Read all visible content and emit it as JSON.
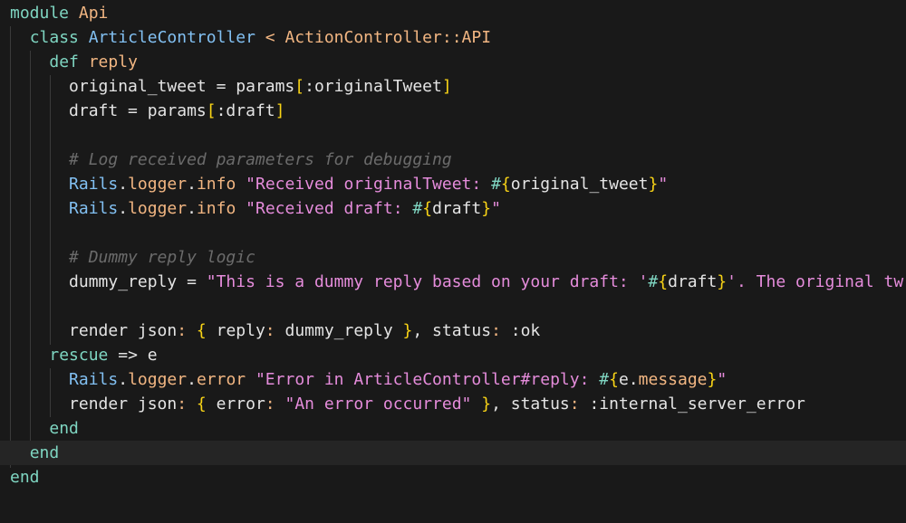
{
  "editor": {
    "current_line": 19,
    "lines": [
      [
        [
          "k",
          "module"
        ],
        [
          "w",
          " "
        ],
        [
          "o",
          "Api"
        ]
      ],
      [
        [
          "w",
          "  "
        ],
        [
          "k",
          "class"
        ],
        [
          "w",
          " "
        ],
        [
          "c",
          "ArticleController"
        ],
        [
          "o",
          " < "
        ],
        [
          "o",
          "ActionController::API"
        ]
      ],
      [
        [
          "w",
          "    "
        ],
        [
          "k",
          "def"
        ],
        [
          "w",
          " "
        ],
        [
          "o",
          "reply"
        ]
      ],
      [
        [
          "w",
          "      original_tweet = params"
        ],
        [
          "y",
          "["
        ],
        [
          "w",
          ":originalTweet"
        ],
        [
          "y",
          "]"
        ]
      ],
      [
        [
          "w",
          "      draft = params"
        ],
        [
          "y",
          "["
        ],
        [
          "w",
          ":draft"
        ],
        [
          "y",
          "]"
        ]
      ],
      [],
      [
        [
          "m",
          "      # Log received parameters for debugging"
        ]
      ],
      [
        [
          "w",
          "      "
        ],
        [
          "c",
          "Rails"
        ],
        [
          "w",
          "."
        ],
        [
          "o",
          "logger"
        ],
        [
          "w",
          "."
        ],
        [
          "o",
          "info"
        ],
        [
          "w",
          " "
        ],
        [
          "s",
          "\"Received originalTweet: "
        ],
        [
          "k",
          "#"
        ],
        [
          "y",
          "{"
        ],
        [
          "w",
          "original_tweet"
        ],
        [
          "y",
          "}"
        ],
        [
          "s",
          "\""
        ]
      ],
      [
        [
          "w",
          "      "
        ],
        [
          "c",
          "Rails"
        ],
        [
          "w",
          "."
        ],
        [
          "o",
          "logger"
        ],
        [
          "w",
          "."
        ],
        [
          "o",
          "info"
        ],
        [
          "w",
          " "
        ],
        [
          "s",
          "\"Received draft: "
        ],
        [
          "k",
          "#"
        ],
        [
          "y",
          "{"
        ],
        [
          "w",
          "draft"
        ],
        [
          "y",
          "}"
        ],
        [
          "s",
          "\""
        ]
      ],
      [],
      [
        [
          "m",
          "      # Dummy reply logic"
        ]
      ],
      [
        [
          "w",
          "      dummy_reply = "
        ],
        [
          "s",
          "\"This is a dummy reply based on your draft: '"
        ],
        [
          "k",
          "#"
        ],
        [
          "y",
          "{"
        ],
        [
          "w",
          "draft"
        ],
        [
          "y",
          "}"
        ],
        [
          "s",
          "'. The original tw"
        ]
      ],
      [],
      [
        [
          "w",
          "      render json"
        ],
        [
          "o",
          ":"
        ],
        [
          "w",
          " "
        ],
        [
          "y",
          "{"
        ],
        [
          "w",
          " reply"
        ],
        [
          "o",
          ":"
        ],
        [
          "w",
          " dummy_reply "
        ],
        [
          "y",
          "}"
        ],
        [
          "w",
          ", status"
        ],
        [
          "o",
          ":"
        ],
        [
          "w",
          " :ok"
        ]
      ],
      [
        [
          "w",
          "    "
        ],
        [
          "k",
          "rescue"
        ],
        [
          "w",
          " => e"
        ]
      ],
      [
        [
          "w",
          "      "
        ],
        [
          "c",
          "Rails"
        ],
        [
          "w",
          "."
        ],
        [
          "o",
          "logger"
        ],
        [
          "w",
          "."
        ],
        [
          "o",
          "error"
        ],
        [
          "w",
          " "
        ],
        [
          "s",
          "\"Error in ArticleController#reply: "
        ],
        [
          "k",
          "#"
        ],
        [
          "y",
          "{"
        ],
        [
          "w",
          "e."
        ],
        [
          "o",
          "message"
        ],
        [
          "y",
          "}"
        ],
        [
          "s",
          "\""
        ]
      ],
      [
        [
          "w",
          "      render json"
        ],
        [
          "o",
          ":"
        ],
        [
          "w",
          " "
        ],
        [
          "y",
          "{"
        ],
        [
          "w",
          " error"
        ],
        [
          "o",
          ":"
        ],
        [
          "w",
          " "
        ],
        [
          "s",
          "\"An error occurred\""
        ],
        [
          "w",
          " "
        ],
        [
          "y",
          "}"
        ],
        [
          "w",
          ", status"
        ],
        [
          "o",
          ":"
        ],
        [
          "w",
          " :internal_server_error"
        ]
      ],
      [
        [
          "w",
          "    "
        ],
        [
          "k",
          "end"
        ]
      ],
      [
        [
          "w",
          "  "
        ],
        [
          "k",
          "end"
        ]
      ],
      [
        [
          "k",
          "end"
        ]
      ]
    ]
  }
}
